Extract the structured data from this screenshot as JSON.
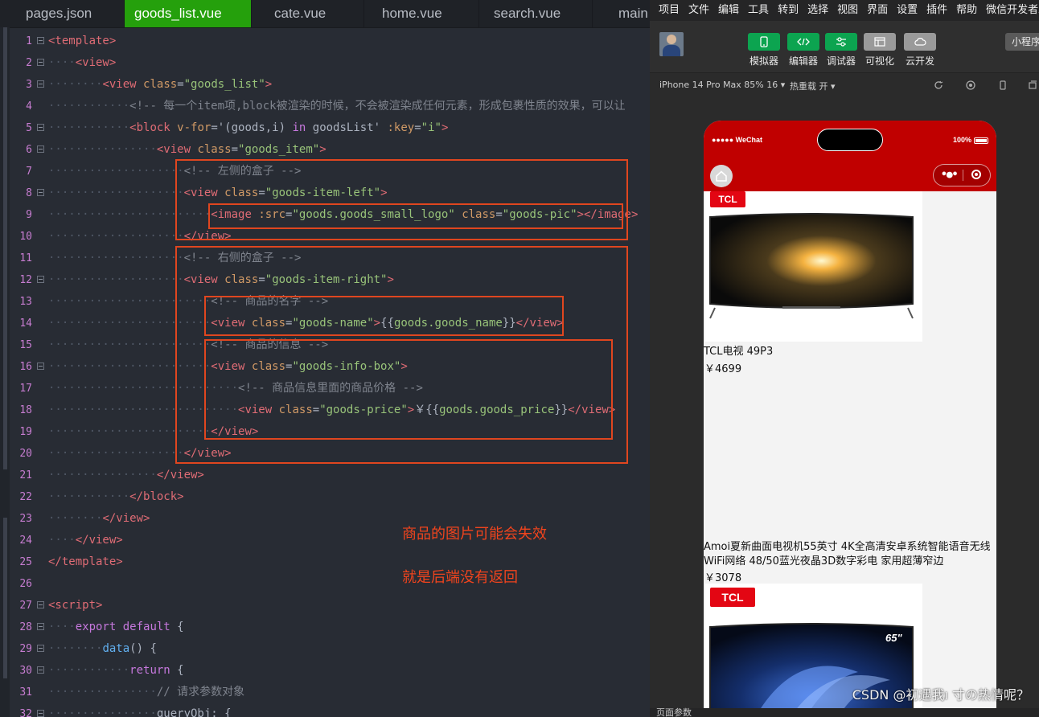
{
  "editor": {
    "tabs": [
      {
        "label": "pages.json",
        "active": false
      },
      {
        "label": "goods_list.vue",
        "active": true
      },
      {
        "label": "cate.vue",
        "active": false
      },
      {
        "label": "home.vue",
        "active": false
      },
      {
        "label": "search.vue",
        "active": false
      },
      {
        "label": "main",
        "active": false
      }
    ],
    "annotations": {
      "line1": "商品的图片可能会失效",
      "line2": "就是后端没有返回"
    }
  },
  "code_lines": [
    {
      "n": "1",
      "fold": true,
      "indent": 0,
      "tokens": [
        [
          "tg",
          "<template>"
        ]
      ]
    },
    {
      "n": "2",
      "fold": true,
      "indent": 1,
      "tokens": [
        [
          "tg",
          "<view>"
        ]
      ]
    },
    {
      "n": "3",
      "fold": true,
      "indent": 2,
      "tokens": [
        [
          "tg",
          "<view"
        ],
        [
          "pl",
          " "
        ],
        [
          "at",
          "class"
        ],
        [
          "pl",
          "="
        ],
        [
          "st",
          "\"goods_list\""
        ],
        [
          "tg",
          ">"
        ]
      ]
    },
    {
      "n": "4",
      "fold": false,
      "indent": 3,
      "tokens": [
        [
          "cm",
          "<!-- 每一个item项,block被渲染的时候，不会被渲染成任何元素，形成包裹性质的效果，可以让"
        ]
      ]
    },
    {
      "n": "5",
      "fold": true,
      "indent": 3,
      "tokens": [
        [
          "tg",
          "<block"
        ],
        [
          "pl",
          " "
        ],
        [
          "at",
          "v-for"
        ],
        [
          "pl",
          "='(goods,i) "
        ],
        [
          "kw",
          "in"
        ],
        [
          "pl",
          " goodsList' "
        ],
        [
          "at",
          ":key"
        ],
        [
          "pl",
          "="
        ],
        [
          "st",
          "\"i\""
        ],
        [
          "tg",
          ">"
        ]
      ]
    },
    {
      "n": "6",
      "fold": true,
      "indent": 4,
      "tokens": [
        [
          "tg",
          "<view"
        ],
        [
          "pl",
          " "
        ],
        [
          "at",
          "class"
        ],
        [
          "pl",
          "="
        ],
        [
          "st",
          "\"goods_item\""
        ],
        [
          "tg",
          ">"
        ]
      ]
    },
    {
      "n": "7",
      "fold": false,
      "indent": 5,
      "tokens": [
        [
          "cm",
          "<!-- 左侧的盒子 -->"
        ]
      ]
    },
    {
      "n": "8",
      "fold": true,
      "indent": 5,
      "tokens": [
        [
          "tg",
          "<view"
        ],
        [
          "pl",
          " "
        ],
        [
          "at",
          "class"
        ],
        [
          "pl",
          "="
        ],
        [
          "st",
          "\"goods-item-left\""
        ],
        [
          "tg",
          ">"
        ]
      ]
    },
    {
      "n": "9",
      "fold": false,
      "indent": 6,
      "tokens": [
        [
          "tg",
          "<image"
        ],
        [
          "pl",
          " "
        ],
        [
          "at",
          ":src"
        ],
        [
          "pl",
          "="
        ],
        [
          "st",
          "\"goods.goods_small_logo\""
        ],
        [
          "pl",
          " "
        ],
        [
          "at",
          "class"
        ],
        [
          "pl",
          "="
        ],
        [
          "st",
          "\"goods-pic\""
        ],
        [
          "tg",
          "></image>"
        ]
      ]
    },
    {
      "n": "10",
      "fold": false,
      "indent": 5,
      "tokens": [
        [
          "tg",
          "</view>"
        ]
      ]
    },
    {
      "n": "11",
      "fold": false,
      "indent": 5,
      "tokens": [
        [
          "cm",
          "<!-- 右侧的盒子 -->"
        ]
      ]
    },
    {
      "n": "12",
      "fold": true,
      "indent": 5,
      "tokens": [
        [
          "tg",
          "<view"
        ],
        [
          "pl",
          " "
        ],
        [
          "at",
          "class"
        ],
        [
          "pl",
          "="
        ],
        [
          "st",
          "\"goods-item-right\""
        ],
        [
          "tg",
          ">"
        ]
      ]
    },
    {
      "n": "13",
      "fold": false,
      "indent": 6,
      "tokens": [
        [
          "cm",
          "<!-- 商品的名字 -->"
        ]
      ]
    },
    {
      "n": "14",
      "fold": false,
      "indent": 6,
      "tokens": [
        [
          "tg",
          "<view"
        ],
        [
          "pl",
          " "
        ],
        [
          "at",
          "class"
        ],
        [
          "pl",
          "="
        ],
        [
          "st",
          "\"goods-name\""
        ],
        [
          "tg",
          ">"
        ],
        [
          "pl",
          "{{"
        ],
        [
          "st",
          "goods.goods_name"
        ],
        [
          "pl",
          "}}"
        ],
        [
          "tg",
          "</view>"
        ]
      ]
    },
    {
      "n": "15",
      "fold": false,
      "indent": 6,
      "tokens": [
        [
          "cm",
          "<!-- 商品的信息 -->"
        ]
      ]
    },
    {
      "n": "16",
      "fold": true,
      "indent": 6,
      "tokens": [
        [
          "tg",
          "<view"
        ],
        [
          "pl",
          " "
        ],
        [
          "at",
          "class"
        ],
        [
          "pl",
          "="
        ],
        [
          "st",
          "\"goods-info-box\""
        ],
        [
          "tg",
          ">"
        ]
      ]
    },
    {
      "n": "17",
      "fold": false,
      "indent": 7,
      "tokens": [
        [
          "cm",
          "<!-- 商品信息里面的商品价格 -->"
        ]
      ]
    },
    {
      "n": "18",
      "fold": false,
      "indent": 7,
      "tokens": [
        [
          "tg",
          "<view"
        ],
        [
          "pl",
          " "
        ],
        [
          "at",
          "class"
        ],
        [
          "pl",
          "="
        ],
        [
          "st",
          "\"goods-price\""
        ],
        [
          "tg",
          ">"
        ],
        [
          "pl",
          "￥{{"
        ],
        [
          "st",
          "goods.goods_price"
        ],
        [
          "pl",
          "}}"
        ],
        [
          "tg",
          "</view>"
        ]
      ]
    },
    {
      "n": "19",
      "fold": false,
      "indent": 6,
      "tokens": [
        [
          "tg",
          "</view>"
        ]
      ]
    },
    {
      "n": "20",
      "fold": false,
      "indent": 5,
      "tokens": [
        [
          "tg",
          "</view>"
        ]
      ]
    },
    {
      "n": "21",
      "fold": false,
      "indent": 4,
      "tokens": [
        [
          "tg",
          "</view>"
        ]
      ]
    },
    {
      "n": "22",
      "fold": false,
      "indent": 3,
      "tokens": [
        [
          "tg",
          "</block>"
        ]
      ]
    },
    {
      "n": "23",
      "fold": false,
      "indent": 2,
      "tokens": [
        [
          "tg",
          "</view>"
        ]
      ]
    },
    {
      "n": "24",
      "fold": false,
      "indent": 1,
      "tokens": [
        [
          "tg",
          "</view>"
        ]
      ]
    },
    {
      "n": "25",
      "fold": false,
      "indent": 0,
      "tokens": [
        [
          "tg",
          "</template>"
        ]
      ]
    },
    {
      "n": "26",
      "fold": false,
      "indent": 0,
      "tokens": []
    },
    {
      "n": "27",
      "fold": true,
      "indent": 0,
      "tokens": [
        [
          "tg",
          "<script>"
        ]
      ]
    },
    {
      "n": "28",
      "fold": true,
      "indent": 1,
      "tokens": [
        [
          "kw",
          "export"
        ],
        [
          "pl",
          " "
        ],
        [
          "kw",
          "default"
        ],
        [
          "pl",
          " {"
        ]
      ]
    },
    {
      "n": "29",
      "fold": true,
      "indent": 2,
      "tokens": [
        [
          "fn",
          "data"
        ],
        [
          "pl",
          "() {"
        ]
      ]
    },
    {
      "n": "30",
      "fold": true,
      "indent": 3,
      "tokens": [
        [
          "kw",
          "return"
        ],
        [
          "pl",
          " {"
        ]
      ]
    },
    {
      "n": "31",
      "fold": false,
      "indent": 4,
      "tokens": [
        [
          "cm",
          "// 请求参数对象"
        ]
      ]
    },
    {
      "n": "32",
      "fold": true,
      "indent": 4,
      "tokens": [
        [
          "pl",
          "queryObj: {"
        ]
      ]
    }
  ],
  "devtools": {
    "menu": [
      "项目",
      "文件",
      "编辑",
      "工具",
      "转到",
      "选择",
      "视图",
      "界面",
      "设置",
      "插件",
      "帮助",
      "微信开发者工"
    ],
    "toolbar": [
      {
        "label": "模拟器",
        "icon": "phone-icon",
        "color": "#0ca450"
      },
      {
        "label": "编辑器",
        "icon": "code-icon",
        "color": "#0ca450"
      },
      {
        "label": "调试器",
        "icon": "debug-icon",
        "color": "#0ca450"
      },
      {
        "label": "可视化",
        "icon": "layout-icon",
        "color": "#9a9a9a"
      },
      {
        "label": "云开发",
        "icon": "cloud-icon",
        "color": "#9a9a9a"
      }
    ],
    "mini_program_label": "小程序",
    "device": "iPhone 14 Pro Max 85% 16",
    "hot_reload": "热重载 开",
    "phone": {
      "carrier": "●●●●● WeChat",
      "battery": "100%",
      "brand_color": "#c00000"
    },
    "goods": [
      {
        "brand": "TCL",
        "name": "TCL电视 49P3",
        "price": "￥4699"
      },
      {
        "brand": "",
        "name": "Amoi夏新曲面电视机55英寸 4K全高清安卓系统智能语音无线WiFi网络 48/50蓝光夜晶3D数字彩电 家用超薄窄边",
        "price": "￥3078"
      },
      {
        "brand": "TCL",
        "name": "",
        "price": "",
        "badge": "65\""
      }
    ],
    "watermark": "CSDN @初遇我ı 寸の热情呢？",
    "bottom_label": "页面参数"
  }
}
